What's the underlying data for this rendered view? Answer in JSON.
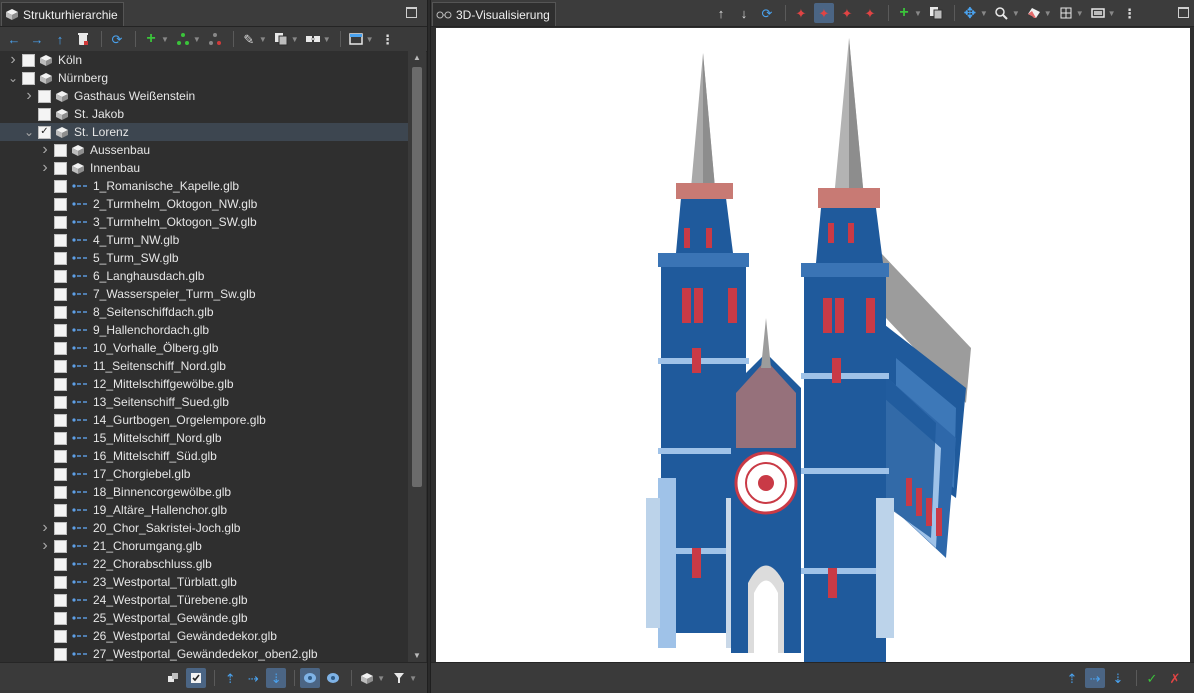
{
  "left_panel": {
    "tab_title": "Strukturhierarchie",
    "toolbar_icons": [
      "back-icon",
      "forward-icon",
      "up-icon",
      "trash-icon",
      "refresh-icon",
      "add-icon",
      "tree-green-icon",
      "tree-red-icon",
      "pencil-icon",
      "copy-icon",
      "link-icon",
      "window-icon",
      "more-icon"
    ],
    "tree": [
      {
        "label": "Köln",
        "level": 0,
        "arrow": "right",
        "checked": false,
        "icon": "cube"
      },
      {
        "label": "Nürnberg",
        "level": 0,
        "arrow": "down",
        "checked": false,
        "icon": "cube"
      },
      {
        "label": "Gasthaus Weißenstein",
        "level": 1,
        "arrow": "right",
        "checked": false,
        "icon": "cube"
      },
      {
        "label": "St. Jakob",
        "level": 1,
        "arrow": "",
        "checked": false,
        "icon": "cube"
      },
      {
        "label": "St. Lorenz",
        "level": 1,
        "arrow": "down",
        "checked": true,
        "icon": "cube",
        "selected": true
      },
      {
        "label": "Aussenbau",
        "level": 2,
        "arrow": "right",
        "checked": false,
        "icon": "cube"
      },
      {
        "label": "Innenbau",
        "level": 2,
        "arrow": "right",
        "checked": false,
        "icon": "cube"
      },
      {
        "label": "1_Romanische_Kapelle.glb",
        "level": 2,
        "arrow": "",
        "checked": false,
        "icon": "glb"
      },
      {
        "label": "2_Turmhelm_Oktogon_NW.glb",
        "level": 2,
        "arrow": "",
        "checked": false,
        "icon": "glb"
      },
      {
        "label": "3_Turmhelm_Oktogon_SW.glb",
        "level": 2,
        "arrow": "",
        "checked": false,
        "icon": "glb"
      },
      {
        "label": "4_Turm_NW.glb",
        "level": 2,
        "arrow": "",
        "checked": false,
        "icon": "glb"
      },
      {
        "label": "5_Turm_SW.glb",
        "level": 2,
        "arrow": "",
        "checked": false,
        "icon": "glb"
      },
      {
        "label": "6_Langhausdach.glb",
        "level": 2,
        "arrow": "",
        "checked": false,
        "icon": "glb"
      },
      {
        "label": "7_Wasserspeier_Turm_Sw.glb",
        "level": 2,
        "arrow": "",
        "checked": false,
        "icon": "glb"
      },
      {
        "label": "8_Seitenschiffdach.glb",
        "level": 2,
        "arrow": "",
        "checked": false,
        "icon": "glb"
      },
      {
        "label": "9_Hallenchordach.glb",
        "level": 2,
        "arrow": "",
        "checked": false,
        "icon": "glb"
      },
      {
        "label": "10_Vorhalle_Ölberg.glb",
        "level": 2,
        "arrow": "",
        "checked": false,
        "icon": "glb"
      },
      {
        "label": "11_Seitenschiff_Nord.glb",
        "level": 2,
        "arrow": "",
        "checked": false,
        "icon": "glb"
      },
      {
        "label": "12_Mittelschiffgewölbe.glb",
        "level": 2,
        "arrow": "",
        "checked": false,
        "icon": "glb"
      },
      {
        "label": "13_Seitenschiff_Sued.glb",
        "level": 2,
        "arrow": "",
        "checked": false,
        "icon": "glb"
      },
      {
        "label": "14_Gurtbogen_Orgelempore.glb",
        "level": 2,
        "arrow": "",
        "checked": false,
        "icon": "glb"
      },
      {
        "label": "15_Mittelschiff_Nord.glb",
        "level": 2,
        "arrow": "",
        "checked": false,
        "icon": "glb"
      },
      {
        "label": "16_Mittelschiff_Süd.glb",
        "level": 2,
        "arrow": "",
        "checked": false,
        "icon": "glb"
      },
      {
        "label": "17_Chorgiebel.glb",
        "level": 2,
        "arrow": "",
        "checked": false,
        "icon": "glb"
      },
      {
        "label": "18_Binnencorgewölbe.glb",
        "level": 2,
        "arrow": "",
        "checked": false,
        "icon": "glb"
      },
      {
        "label": "19_Altäre_Hallenchor.glb",
        "level": 2,
        "arrow": "",
        "checked": false,
        "icon": "glb"
      },
      {
        "label": "20_Chor_Sakristei-Joch.glb",
        "level": 2,
        "arrow": "right",
        "checked": false,
        "icon": "glb"
      },
      {
        "label": "21_Chorumgang.glb",
        "level": 2,
        "arrow": "right",
        "checked": false,
        "icon": "glb"
      },
      {
        "label": "22_Chorabschluss.glb",
        "level": 2,
        "arrow": "",
        "checked": false,
        "icon": "glb"
      },
      {
        "label": "23_Westportal_Türblatt.glb",
        "level": 2,
        "arrow": "",
        "checked": false,
        "icon": "glb"
      },
      {
        "label": "24_Westportal_Türebene.glb",
        "level": 2,
        "arrow": "",
        "checked": false,
        "icon": "glb"
      },
      {
        "label": "25_Westportal_Gewände.glb",
        "level": 2,
        "arrow": "",
        "checked": false,
        "icon": "glb"
      },
      {
        "label": "26_Westportal_Gewändedekor.glb",
        "level": 2,
        "arrow": "",
        "checked": false,
        "icon": "glb"
      },
      {
        "label": "27_Westportal_Gewändedekor_oben2.glb",
        "level": 2,
        "arrow": "",
        "checked": false,
        "icon": "glb"
      }
    ]
  },
  "right_panel": {
    "tab_title": "3D-Visualisierung"
  },
  "colors": {
    "model_blue": "#1f5a9c",
    "spire_gray": "#a9a9a9",
    "roof_gray": "#9c9c9c",
    "accent_red": "#d23a3a",
    "window_red": "#c93a46"
  }
}
